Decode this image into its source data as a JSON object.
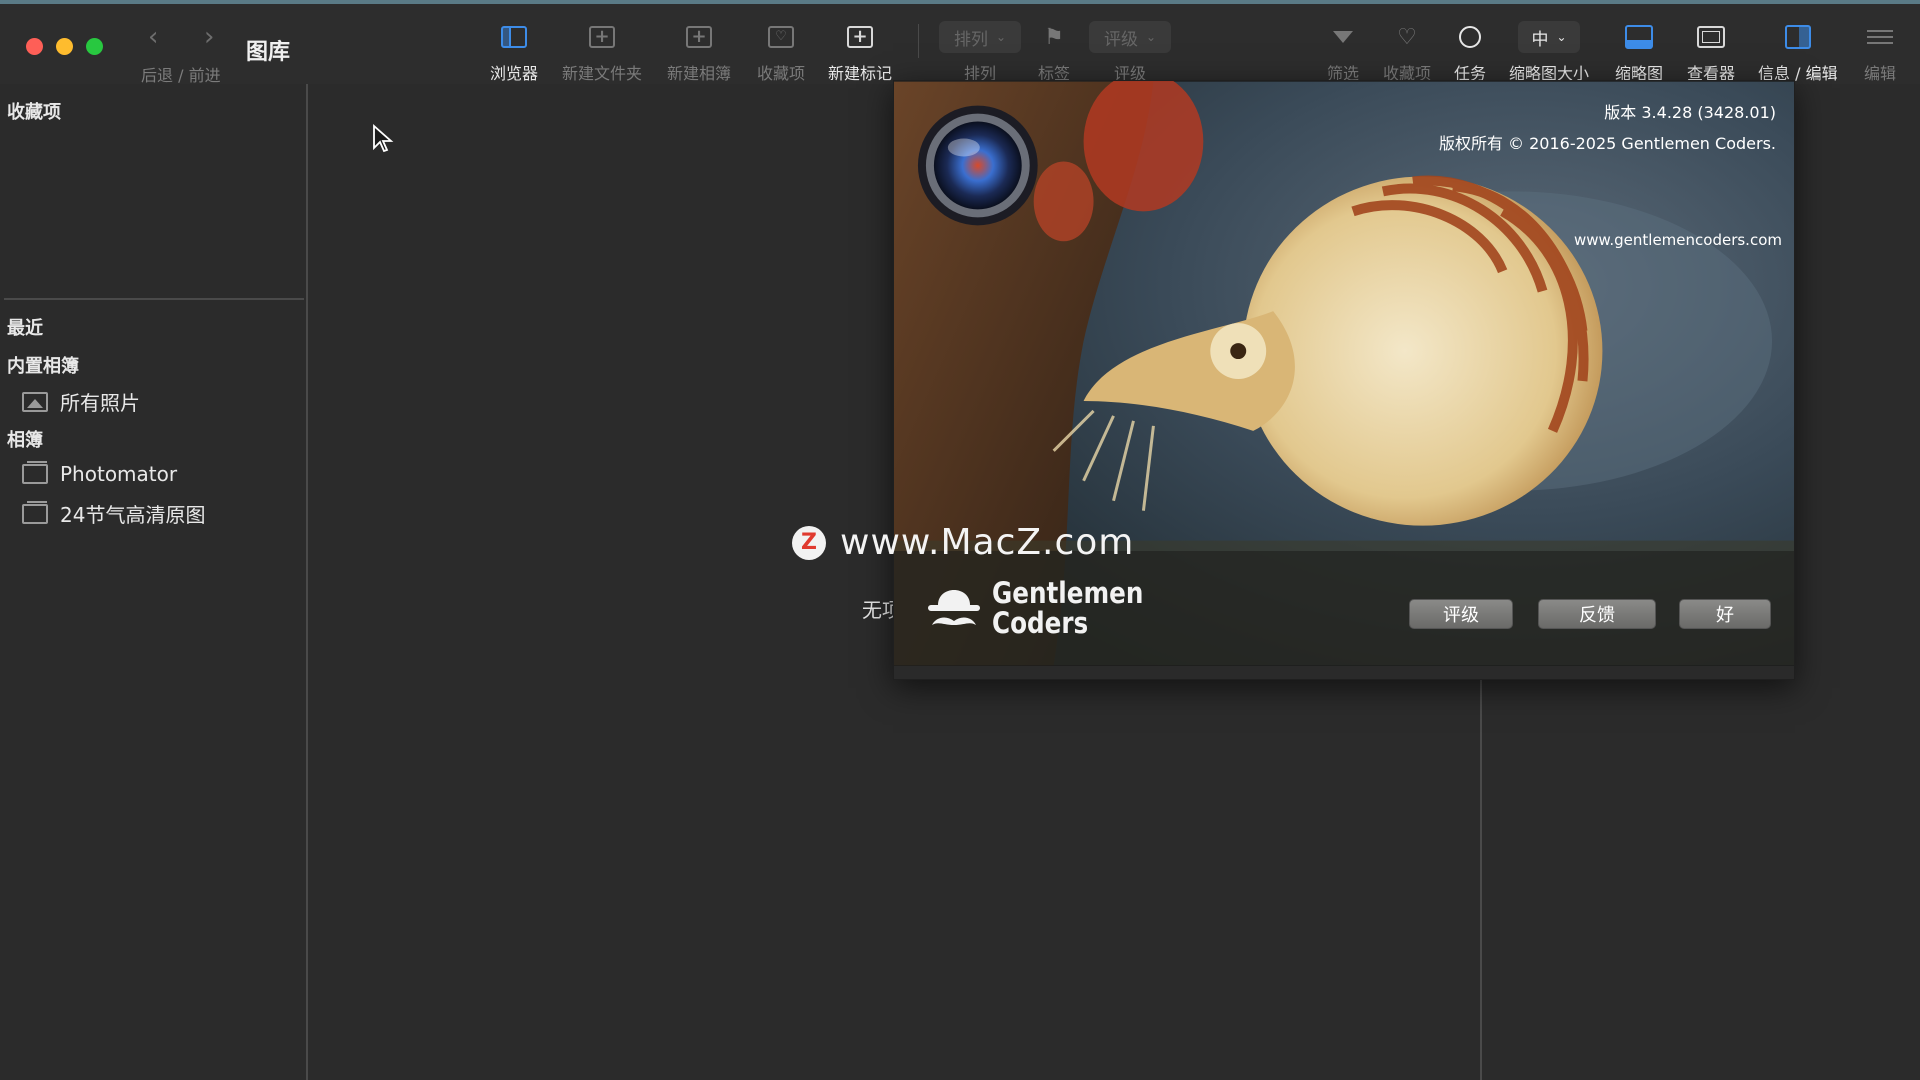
{
  "window": {
    "title": "图库",
    "nav_back_glyph": "‹",
    "nav_forward_glyph": "›",
    "nav_label": "后退 / 前进"
  },
  "toolbar": {
    "browser": "浏览器",
    "new_folder": "新建文件夹",
    "new_album": "新建相簿",
    "favorites": "收藏项",
    "new_tag": "新建标记",
    "sort_dropdown": "排列",
    "sort_label": "排列",
    "flag_label": "标签",
    "rating_dropdown": "评级",
    "rating_label": "评级",
    "filter": "筛选",
    "favorites_filter": "收藏项",
    "tasks": "任务",
    "thumb_size_value": "中",
    "thumb_size_label": "缩略图大小",
    "thumbnails": "缩略图",
    "viewer": "查看器",
    "info_edit": "信息 / 编辑",
    "edit": "编辑"
  },
  "sidebar": {
    "favorites_header": "收藏项",
    "recent": "最近",
    "builtin_albums_header": "内置相簿",
    "all_photos": "所有照片",
    "albums_header": "相簿",
    "albums": [
      {
        "label": "Photomator"
      },
      {
        "label": "24节气高清原图"
      }
    ]
  },
  "main": {
    "empty_text": "无项"
  },
  "watermark": {
    "logo_letter": "Z",
    "text": "www.MacZ.com"
  },
  "about": {
    "version": "版本 3.4.28 (3428.01)",
    "copyright": "版权所有 © 2016-2025 Gentlemen Coders.",
    "website": "www.gentlemencoders.com",
    "brand_line1": "Gentlemen",
    "brand_line2": "Coders",
    "buttons": {
      "rate": "评级",
      "feedback": "反馈",
      "ok": "好"
    }
  },
  "colors": {
    "accent": "#3d8ce8",
    "background": "#2b2b2b",
    "close": "#fe5f57",
    "minimize": "#febc2e",
    "zoom": "#28c840"
  }
}
